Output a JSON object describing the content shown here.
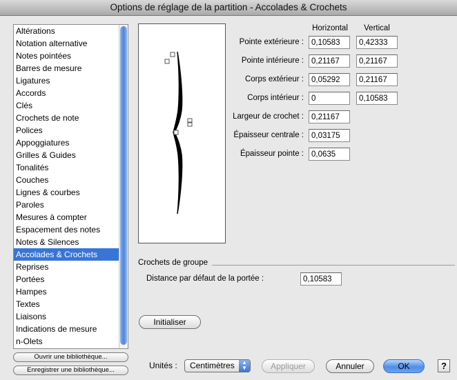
{
  "window": {
    "title": "Options de réglage de la partition - Accolades & Crochets"
  },
  "sidebar": {
    "items": [
      "Altérations",
      "Notation alternative",
      "Notes pointées",
      "Barres de mesure",
      "Ligatures",
      "Accords",
      "Clés",
      "Crochets de note",
      "Polices",
      "Appoggiatures",
      "Grilles & Guides",
      "Tonalités",
      "Couches",
      "Lignes & courbes",
      "Paroles",
      "Mesures à compter",
      "Espacement des notes",
      "Notes & Silences",
      "Accolades & Crochets",
      "Reprises",
      "Portées",
      "Hampes",
      "Textes",
      "Liaisons",
      "Indications de mesure",
      "n-Olets"
    ],
    "selected_index": 18,
    "open_library_label": "Ouvrir une bibliothèque...",
    "save_library_label": "Enregistrer une bibliothèque..."
  },
  "settings": {
    "col_horizontal": "Horizontal",
    "col_vertical": "Vertical",
    "pointe_ext": {
      "label": "Pointe extérieure :",
      "h": "0,10583",
      "v": "0,42333"
    },
    "pointe_int": {
      "label": "Pointe intérieure :",
      "h": "0,21167",
      "v": "0,21167"
    },
    "corps_ext": {
      "label": "Corps extérieur :",
      "h": "0,05292",
      "v": "0,21167"
    },
    "corps_int": {
      "label": "Corps intérieur :",
      "h": "0",
      "v": "0,10583"
    },
    "largeur": {
      "label": "Largeur de crochet :",
      "value": "0,21167"
    },
    "epaisseur_c": {
      "label": "Épaisseur centrale :",
      "value": "0,03175"
    },
    "epaisseur_p": {
      "label": "Épaisseur pointe :",
      "value": "0,0635"
    }
  },
  "group": {
    "title": "Crochets de groupe",
    "distance_label": "Distance par défaut de la portée :",
    "distance_value": "0,10583"
  },
  "buttons": {
    "initialiser": "Initialiser",
    "appliquer": "Appliquer",
    "annuler": "Annuler",
    "ok": "OK",
    "help": "?"
  },
  "units": {
    "label": "Unités :",
    "value": "Centimètres"
  },
  "icons": {
    "select_arrows": "updown-arrows-icon",
    "handle": "square-handle-icon"
  }
}
